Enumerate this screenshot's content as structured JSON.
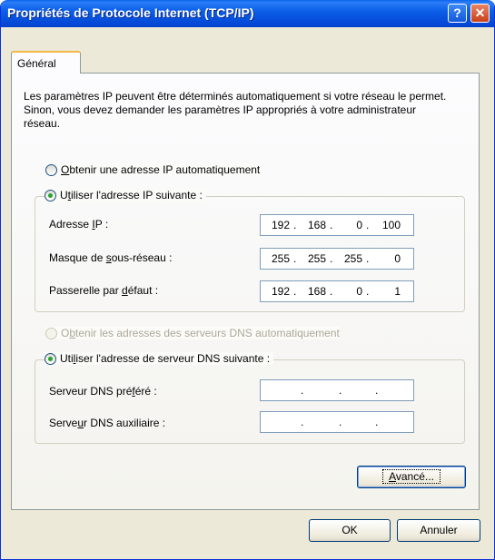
{
  "window": {
    "title": "Propriétés de Protocole Internet (TCP/IP)",
    "help_glyph": "?",
    "close_glyph": "✕"
  },
  "tabs": [
    {
      "label": "Général",
      "selected": true
    }
  ],
  "intro_text": "Les paramètres IP peuvent être déterminés automatiquement si votre réseau le permet. Sinon, vous devez demander les paramètres IP appropriés à votre administrateur réseau.",
  "ip_section": {
    "auto_option": {
      "label_mnemonic": "O",
      "label_rest": "btenir une adresse IP automatiquement",
      "checked": false
    },
    "manual_option": {
      "label_start": "U",
      "label_mnemonic": "t",
      "label_rest": "iliser l'adresse IP suivante :",
      "checked": true
    },
    "fields": [
      {
        "label_start": "Adresse ",
        "label_mnemonic": "I",
        "label_rest": "P :",
        "octets": [
          "192",
          "168",
          "0",
          "100"
        ]
      },
      {
        "label_start": "Masque de ",
        "label_mnemonic": "s",
        "label_rest": "ous-réseau :",
        "octets": [
          "255",
          "255",
          "255",
          "0"
        ]
      },
      {
        "label_start": "Passerelle par ",
        "label_mnemonic": "d",
        "label_rest": "éfaut :",
        "octets": [
          "192",
          "168",
          "0",
          "1"
        ]
      }
    ]
  },
  "dns_section": {
    "auto_option": {
      "label_start": "O",
      "label_mnemonic": "b",
      "label_rest": "tenir les adresses des serveurs DNS automatiquement",
      "checked": false,
      "disabled": true
    },
    "manual_option": {
      "label_start": "Uti",
      "label_mnemonic": "l",
      "label_rest": "iser l'adresse de serveur DNS suivante :",
      "checked": true
    },
    "fields": [
      {
        "label_start": "Serveur DNS pré",
        "label_mnemonic": "f",
        "label_rest": "éré :",
        "octets": [
          "",
          "",
          "",
          ""
        ]
      },
      {
        "label_start": "Serve",
        "label_mnemonic": "u",
        "label_rest": "r DNS auxiliaire :",
        "octets": [
          "",
          "",
          "",
          ""
        ]
      }
    ]
  },
  "advanced_button": {
    "label_mnemonic": "A",
    "label_rest": "vancé..."
  },
  "ok_button": {
    "label": "OK"
  },
  "cancel_button": {
    "label": "Annuler"
  }
}
